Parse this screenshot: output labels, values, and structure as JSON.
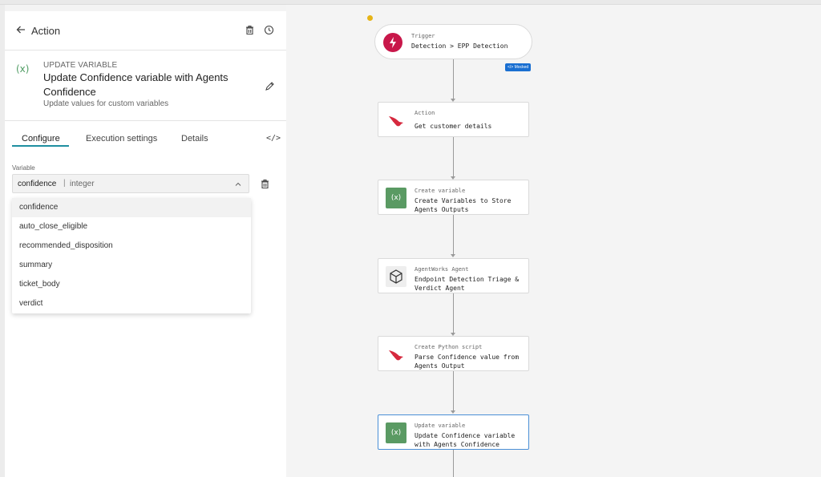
{
  "panel": {
    "title": "Action",
    "icons": {
      "back": "arrow-left-icon",
      "delete": "trash-icon",
      "history": "history-icon"
    }
  },
  "info": {
    "icon_glyph": "(x)",
    "kind": "UPDATE VARIABLE",
    "title": "Update Confidence variable with Agents Confidence",
    "description": "Update values for custom variables",
    "edit_icon": "pencil-icon"
  },
  "tabs": [
    {
      "label": "Configure",
      "active": true
    },
    {
      "label": "Execution settings",
      "active": false
    },
    {
      "label": "Details",
      "active": false
    }
  ],
  "code_glyph": "</>",
  "field": {
    "label": "Variable",
    "value": "confidence",
    "separator": "|",
    "type": "integer"
  },
  "dropdown_options": [
    "confidence",
    "auto_close_eligible",
    "recommended_disposition",
    "summary",
    "ticket_body",
    "verdict"
  ],
  "workflow": {
    "trigger": {
      "kind": "Trigger",
      "name": "Detection > EPP Detection",
      "badge": "</> Mocked",
      "icon": "lightning-icon",
      "warning_icon": "warning-dot-icon"
    },
    "nodes": [
      {
        "kind": "Action",
        "name": "Get customer details",
        "icon": "falcon-icon"
      },
      {
        "kind": "Create variable",
        "name": "Create Variables to Store Agents Outputs",
        "icon": "variable-icon",
        "glyph": "(x)"
      },
      {
        "kind": "AgentWorks Agent",
        "name": "Endpoint Detection Triage & Verdict Agent",
        "icon": "cube-icon"
      },
      {
        "kind": "Create Python script",
        "name": "Parse Confidence value from Agents Output",
        "icon": "falcon-icon"
      },
      {
        "kind": "Update variable",
        "name": "Update Confidence variable with Agents Confidence",
        "icon": "variable-icon",
        "glyph": "(x)",
        "selected": true
      }
    ]
  },
  "colors": {
    "accent": "#1f8fa0",
    "trigger": "#c8174a",
    "variable": "#5a9a63",
    "selected_border": "#4a8fd6",
    "mocked_badge": "#1a6fd1"
  }
}
